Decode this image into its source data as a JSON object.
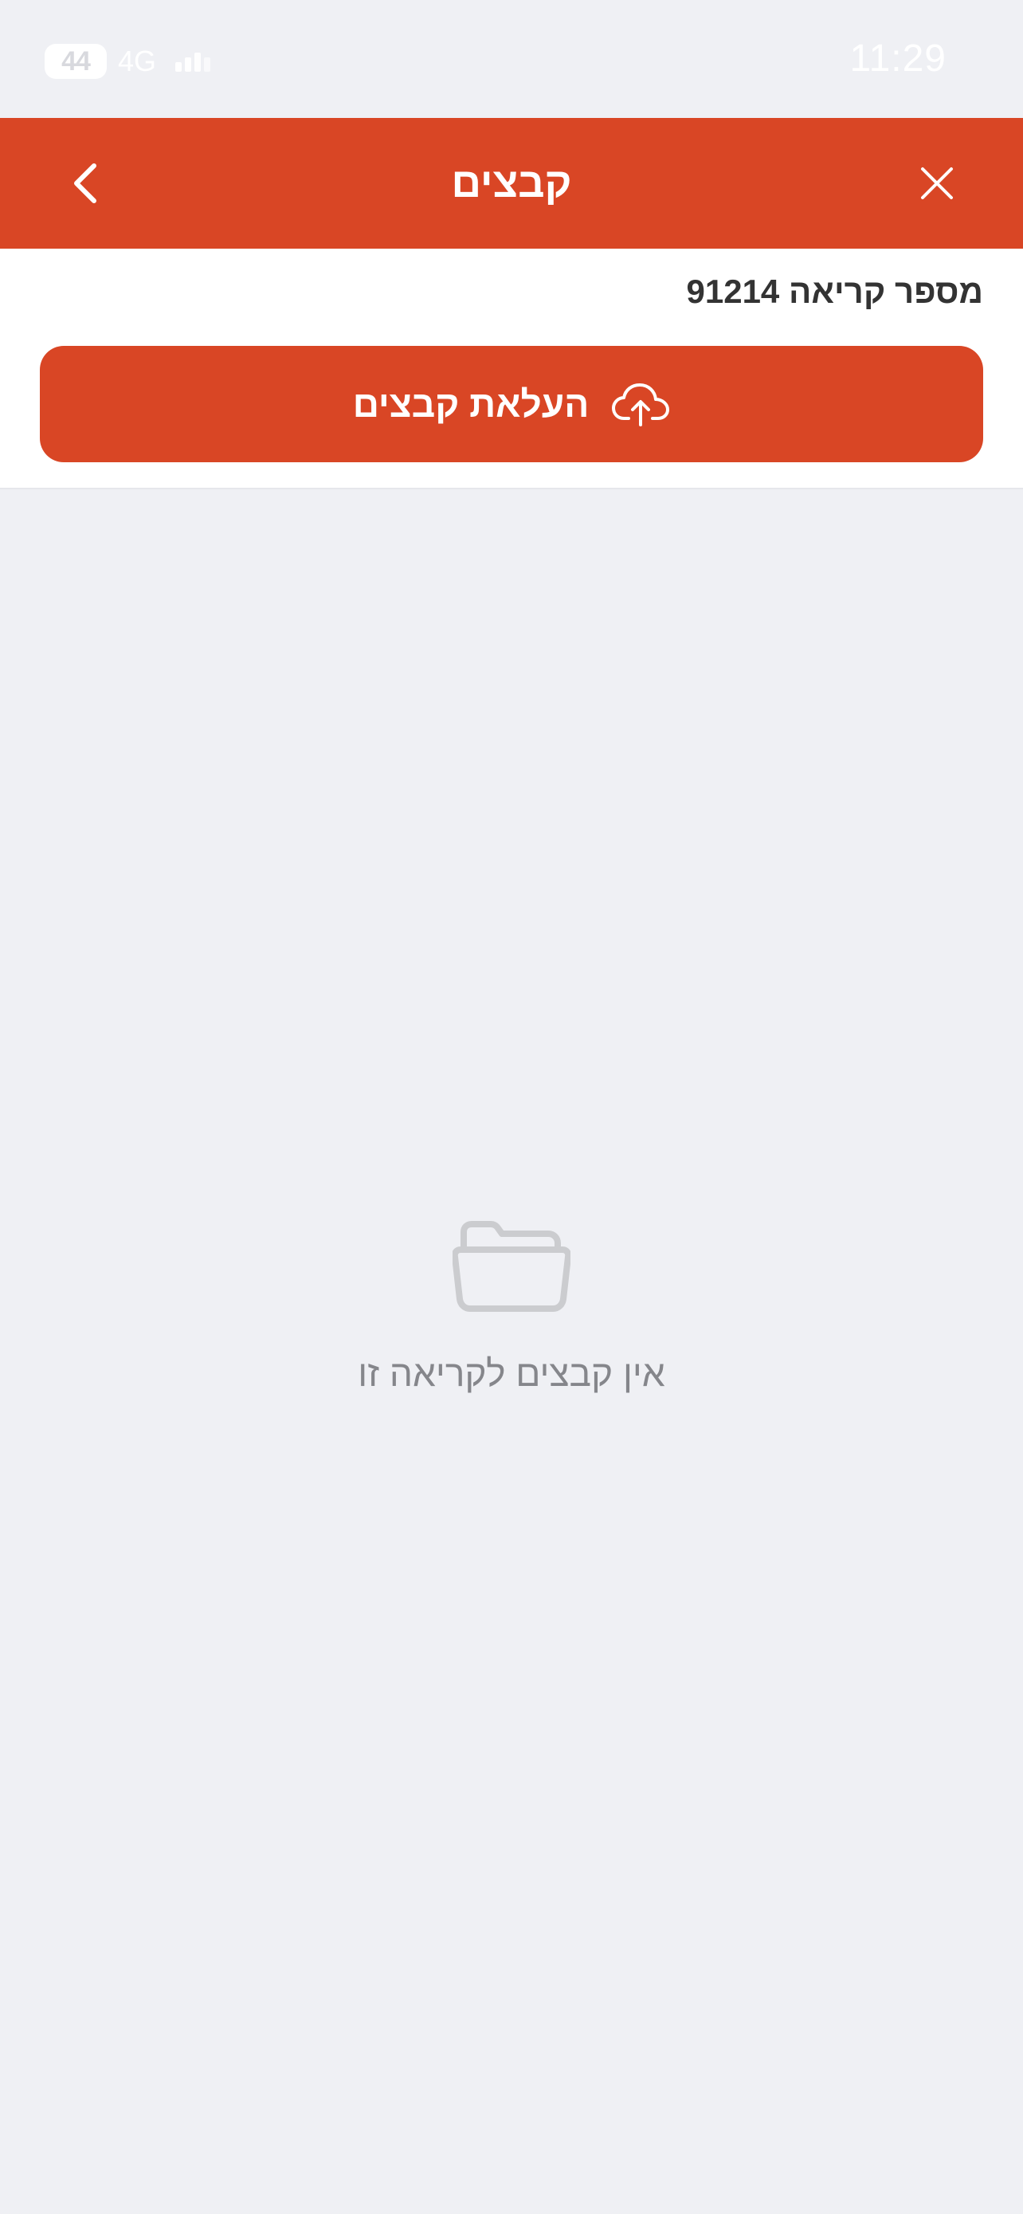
{
  "status_bar": {
    "time": "11:29",
    "battery": "44",
    "network": "4G"
  },
  "navbar": {
    "title": "קבצים",
    "back_icon": "chevron-left-icon",
    "close_icon": "close-icon"
  },
  "header": {
    "call_number": "מספר קריאה 91214",
    "upload_label": "העלאת קבצים",
    "upload_icon": "cloud-upload-icon"
  },
  "empty_state": {
    "icon": "folder-icon",
    "message": "אין קבצים לקריאה זו"
  },
  "colors": {
    "accent": "#d94625",
    "background": "#eff0f4",
    "empty_text": "#85868b"
  }
}
